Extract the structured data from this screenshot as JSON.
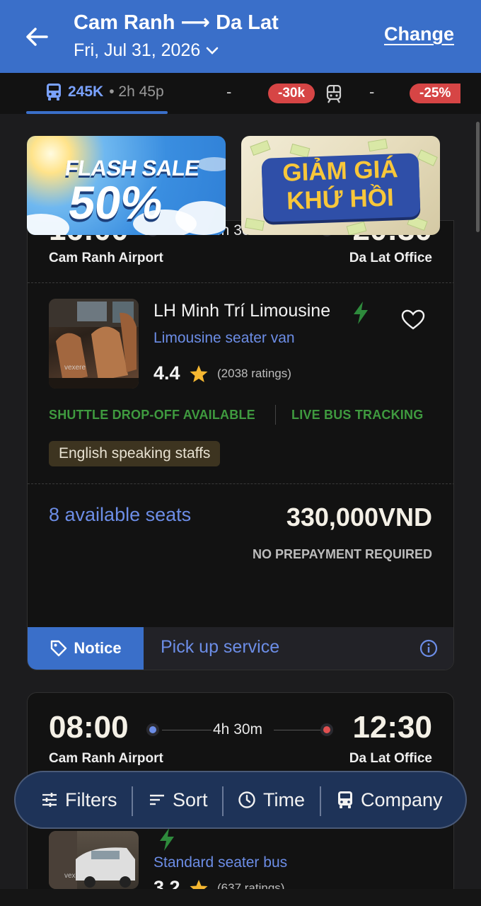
{
  "header": {
    "route": "Cam Ranh ⟶ Da Lat",
    "date": "Fri, Jul 31, 2026",
    "change_label": "Change"
  },
  "tabs": {
    "bus_price": "245K",
    "bus_duration": "• 2h 45p",
    "plane_value": "-",
    "plane_badge": "-30k",
    "train_value": "-",
    "train_badge": "-25%"
  },
  "banners": {
    "flash_line1": "FLASH SALE",
    "flash_line2": "50%",
    "promo_line1": "GIẢM GIÁ",
    "promo_line2": "KHỨ HỒI"
  },
  "trips": [
    {
      "depart_time": "16:00",
      "depart_stop": "Cam Ranh Airport",
      "duration": "4h 30m",
      "arrive_time": "20:30",
      "arrive_stop": "Da Lat Office",
      "operator": "LH Minh Trí Limousine",
      "vehicle": "Limousine seater van",
      "rating": "4.4",
      "rating_count": "(2038 ratings)",
      "features": [
        "SHUTTLE DROP-OFF AVAILABLE",
        "LIVE BUS TRACKING"
      ],
      "tag": "English speaking staffs",
      "seats": "8 available seats",
      "price": "330,000VND",
      "prepay": "NO PREPAYMENT REQUIRED",
      "notice_label": "Notice",
      "notice_text": "Pick up service",
      "thumb_watermark": "vexere"
    },
    {
      "depart_time": "08:00",
      "depart_stop": "Cam Ranh Airport",
      "duration": "4h 30m",
      "arrive_time": "12:30",
      "arrive_stop": "Da Lat Office",
      "vehicle": "Standard seater bus",
      "rating": "3.2",
      "rating_count": "(637 ratings)",
      "thumb_watermark": "vexere"
    }
  ],
  "filters": {
    "filters_label": "Filters",
    "sort_label": "Sort",
    "time_label": "Time",
    "company_label": "Company"
  },
  "colors": {
    "brand_blue": "#3a6fc9",
    "accent_blue": "#6c8de6",
    "feature_green": "#3f9a3f",
    "badge_red": "#d64545",
    "star": "#f5b731"
  }
}
